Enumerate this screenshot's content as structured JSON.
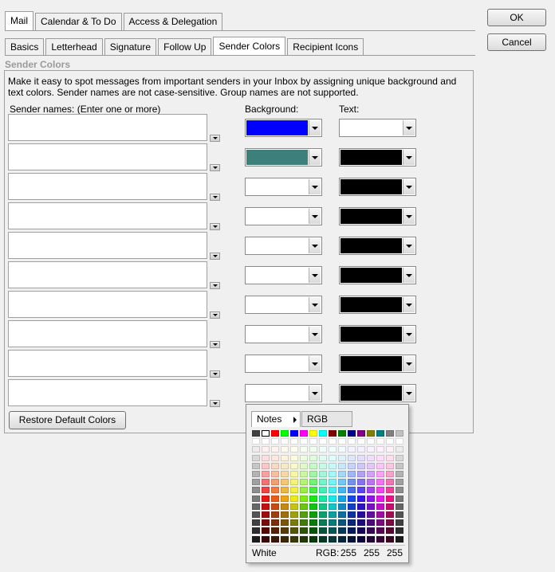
{
  "top_tabs": [
    "Mail",
    "Calendar & To Do",
    "Access & Delegation"
  ],
  "sub_tabs": [
    "Basics",
    "Letterhead",
    "Signature",
    "Follow Up",
    "Sender Colors",
    "Recipient Icons"
  ],
  "buttons": {
    "ok": "OK",
    "cancel": "Cancel",
    "restore": "Restore Default Colors"
  },
  "group_title": "Sender Colors",
  "description": "Make it easy to spot messages from important senders in your Inbox by assigning unique background and text colors.  Sender names are not case-sensitive. Group names are not supported.",
  "headers": {
    "names": "Sender names: (Enter one or more)",
    "background": "Background:",
    "text": "Text:"
  },
  "rows": [
    {
      "name": "",
      "background": "#0000ff",
      "text": "#ffffff"
    },
    {
      "name": "",
      "background": "#3d7f7a",
      "text": "#000000"
    },
    {
      "name": "",
      "background": "#ffffff",
      "text": "#000000"
    },
    {
      "name": "",
      "background": "#ffffff",
      "text": "#000000"
    },
    {
      "name": "",
      "background": "#ffffff",
      "text": "#000000"
    },
    {
      "name": "",
      "background": "#ffffff",
      "text": "#000000"
    },
    {
      "name": "",
      "background": "#ffffff",
      "text": "#000000"
    },
    {
      "name": "",
      "background": "#ffffff",
      "text": "#000000"
    },
    {
      "name": "",
      "background": "#ffffff",
      "text": "#000000"
    },
    {
      "name": "",
      "background": "#ffffff",
      "text": "#000000"
    }
  ],
  "color_popup": {
    "tabs": [
      "Notes",
      "RGB"
    ],
    "selected_name": "White",
    "rgb_label": "RGB:",
    "rgb": [
      "255",
      "255",
      "255"
    ]
  }
}
